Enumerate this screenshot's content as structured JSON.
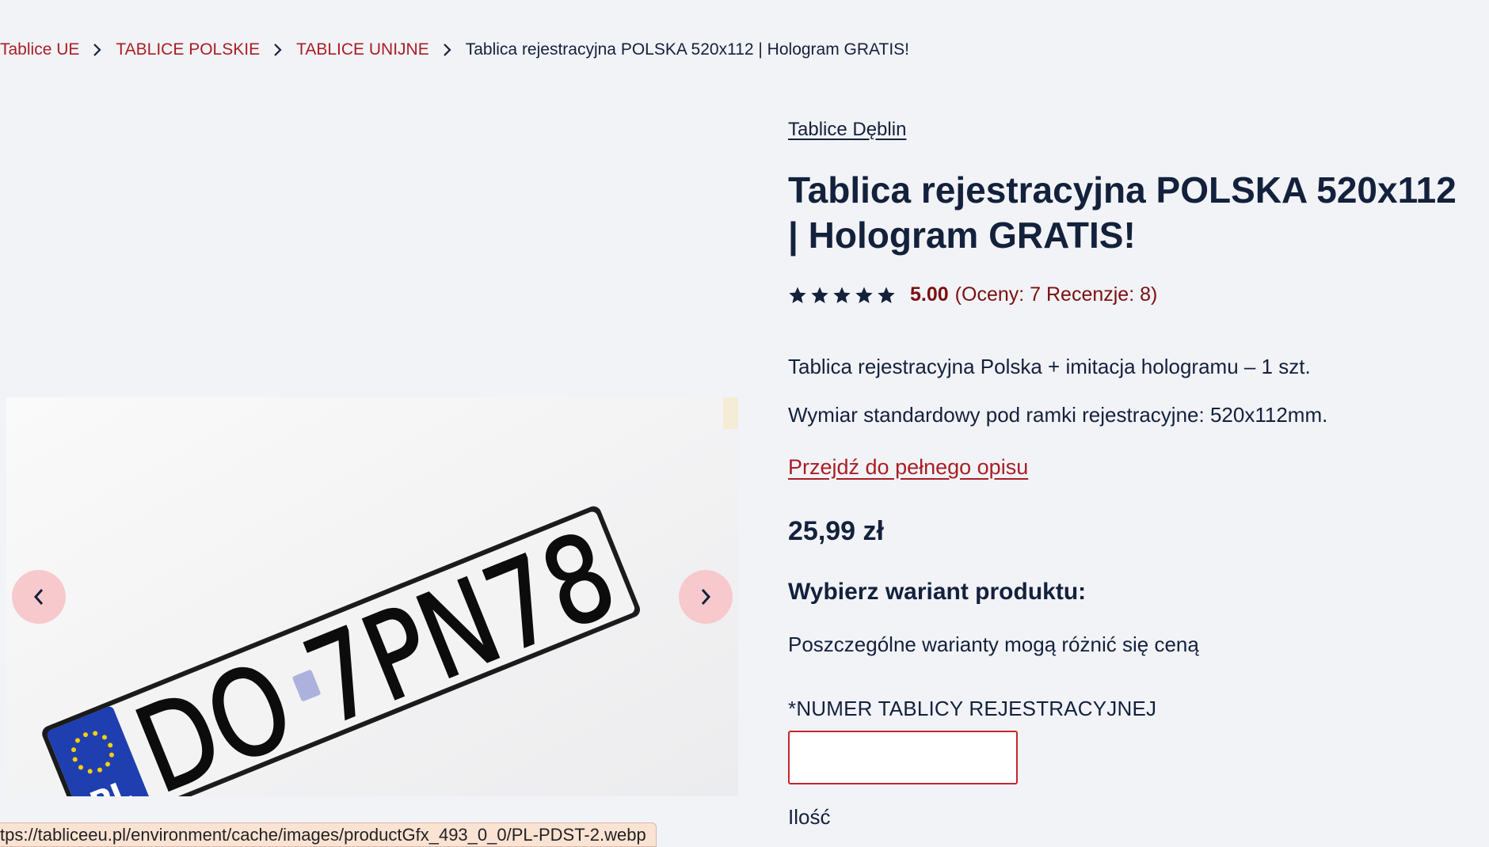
{
  "breadcrumb": {
    "items": [
      {
        "label": "Tablice UE"
      },
      {
        "label": "TABLICE POLSKIE"
      },
      {
        "label": "TABLICE UNIJNE"
      },
      {
        "label": "Tablica rejestracyjna POLSKA 520x112 | Hologram GRATIS!"
      }
    ]
  },
  "product": {
    "brand": "Tablice Dęblin",
    "title": "Tablica rejestracyjna POLSKA 520x112 | Hologram GRATIS!",
    "rating_value": "5.00",
    "rating_stars": 5,
    "rating_counts": "(Oceny: 7 Recenzje: 8)",
    "desc_line1": "Tablica rejestracyjna Polska + imitacja hologramu – 1 szt.",
    "desc_line2": "Wymiar standardowy pod ramki rejestracyjne: 520x112mm.",
    "full_desc_link": "Przejdź do pełnego opisu",
    "price": "25,99 zł",
    "variant_heading": "Wybierz wariant produktu:",
    "variant_note": "Poszczególne warianty mogą różnić się ceną",
    "plate_field_label": "*NUMER TABLICY REJESTRACYJNEJ",
    "plate_field_value": "",
    "qty_label_partial": "Ilość"
  },
  "gallery": {
    "plate_country": "PL",
    "plate_number": "DO 7PN78",
    "prev_icon": "chevron-left-icon",
    "next_icon": "chevron-right-icon"
  },
  "statusbar": {
    "url": "tps://tabliceeu.pl/environment/cache/images/productGfx_493_0_0/PL-PDST-2.webp"
  },
  "colors": {
    "accent": "#a81e24",
    "text": "#13213c",
    "background": "#f2f3f7",
    "nav_button": "#f7c9cc",
    "eu_blue": "#1f3fb0"
  }
}
